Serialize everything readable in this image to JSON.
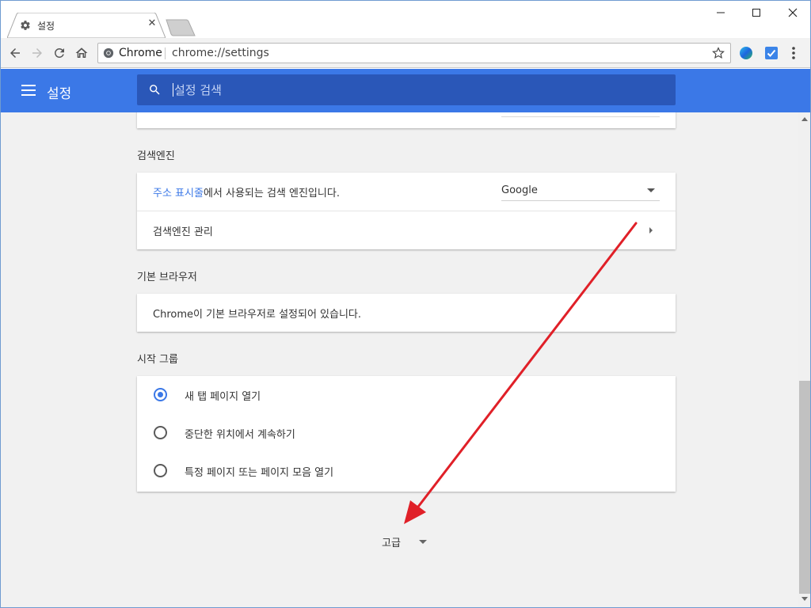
{
  "window": {
    "tab_title": "설정",
    "minimize_label": "",
    "maximize_label": "",
    "close_label": ""
  },
  "toolbar": {
    "omnibox_site": "Chrome",
    "omnibox_url": "chrome://settings"
  },
  "appbar": {
    "title": "설정",
    "search_placeholder": "설정 검색"
  },
  "sections": {
    "search_engine": {
      "title": "검색엔진",
      "row1_link": "주소 표시줄",
      "row1_text": "에서 사용되는 검색 엔진입니다.",
      "engine_selected": "Google",
      "row2_label": "검색엔진 관리"
    },
    "default_browser": {
      "title": "기본 브라우저",
      "status_text": "Chrome이 기본 브라우저로 설정되어 있습니다."
    },
    "startup": {
      "title": "시작 그룹",
      "options": [
        {
          "label": "새 탭 페이지 열기",
          "checked": true
        },
        {
          "label": "중단한 위치에서 계속하기",
          "checked": false
        },
        {
          "label": "특정 페이지 또는 페이지 모음 열기",
          "checked": false
        }
      ]
    }
  },
  "advanced": {
    "label": "고급"
  },
  "colors": {
    "accent": "#3b78e7",
    "appbar": "#3b78e7",
    "search_bg": "#2a57b8",
    "annotation_arrow": "#e02028"
  },
  "icons": {
    "tab_icon": "gear-icon",
    "back": "arrow-left-icon",
    "forward": "arrow-right-icon",
    "reload": "reload-icon",
    "home": "home-icon",
    "star": "star-icon",
    "menu": "hamburger-icon",
    "search": "search-icon"
  }
}
